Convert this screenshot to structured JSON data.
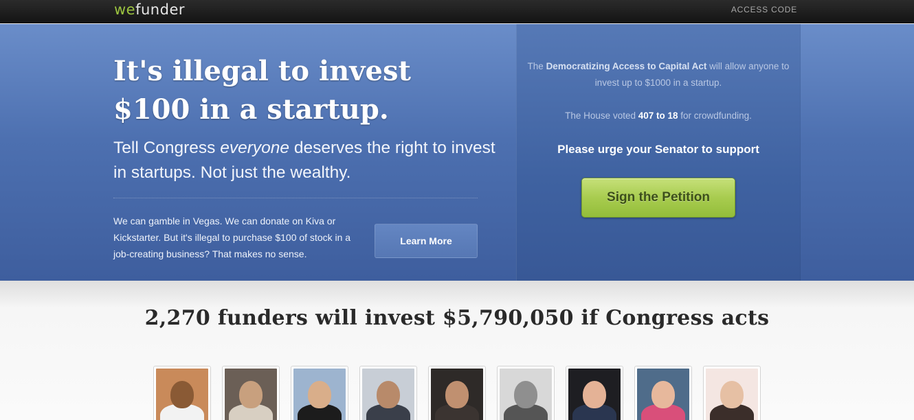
{
  "header": {
    "logo_we": "we",
    "logo_funder": "funder",
    "access_code": "ACCESS CODE"
  },
  "hero": {
    "headline_line1": "It's illegal to invest",
    "headline_line2": "$100 in a startup.",
    "subhead_pre": "Tell Congress ",
    "subhead_em": "everyone",
    "subhead_post": " deserves the right to invest in startups. Not just the wealthy.",
    "blurb": "We can gamble in Vegas. We can donate on Kiva or Kickstarter. But it's illegal to purchase $100 of stock in a job-creating business? That makes no sense.",
    "learn_more": "Learn More"
  },
  "petition": {
    "act_pre": "The ",
    "act_name": "Democratizing Access to Capital Act",
    "act_post": " will allow anyone to invest up to $1000 in a startup.",
    "vote_pre": "The House voted ",
    "vote_count": "407 to 18",
    "vote_post": " for crowdfunding.",
    "urge": "Please urge your Senator to support",
    "button": "Sign the Petition"
  },
  "funders": {
    "title": "2,270 funders will invest $5,790,050 if Congress acts",
    "avatars": [
      {
        "bg": "#c98a5a",
        "face": "#8a5a35",
        "body": "#f2f2f2"
      },
      {
        "bg": "#6b5f56",
        "face": "#c8a07e",
        "body": "#d8cfc2"
      },
      {
        "bg": "#9db4cf",
        "face": "#d9ae8a",
        "body": "#1c1c1c"
      },
      {
        "bg": "#c8ced6",
        "face": "#b88a6a",
        "body": "#3a3f4a"
      },
      {
        "bg": "#2e2a28",
        "face": "#c09070",
        "body": "#3b3431"
      },
      {
        "bg": "#d8d8d8",
        "face": "#8f8f8f",
        "body": "#555555"
      },
      {
        "bg": "#1e1e22",
        "face": "#e4b296",
        "body": "#2a3650"
      },
      {
        "bg": "#4f6c8a",
        "face": "#e7b89c",
        "body": "#d94f7a"
      },
      {
        "bg": "#f4e6e2",
        "face": "#e6c0a4",
        "body": "#3b2e2a"
      }
    ]
  }
}
